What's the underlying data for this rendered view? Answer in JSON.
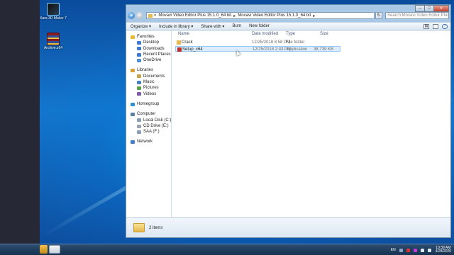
{
  "desktop": {
    "icons": [
      {
        "label": "Xara 3D Maker 7",
        "color": "#1b1b1b",
        "accent": "#7fd4ff"
      },
      {
        "label": "Archive.z64",
        "color": "#8b1c1c",
        "accent": "#e8c23a"
      }
    ]
  },
  "explorer": {
    "address_segments": [
      "Movavi Video Editor Plus 15.1.0_64 bit",
      "▸",
      "Movavi Video Editor Plus 15.1.0_64 bit",
      "▸"
    ],
    "search_placeholder": "Search Movavi Video Editor Plus 15.1.0_64 bit",
    "window_controls": [
      "–",
      "□",
      "x"
    ],
    "toolbar": [
      "Organize ▾",
      "Include in library ▾",
      "Share with ▾",
      "Burn",
      "New folder"
    ],
    "nav_groups": [
      {
        "items": [
          {
            "label": "Favorites",
            "color": "#e7b930",
            "name": "nav-favorites"
          },
          {
            "label": "Desktop",
            "color": "#3a7bd5",
            "name": "nav-desktop"
          },
          {
            "label": "Downloads",
            "color": "#3a7bd5",
            "name": "nav-downloads"
          },
          {
            "label": "Recent Places",
            "color": "#3a7bd5",
            "name": "nav-recent-places"
          },
          {
            "label": "OneDrive",
            "color": "#4f8fe0",
            "name": "nav-onedrive"
          }
        ]
      },
      {
        "items": [
          {
            "label": "Libraries",
            "color": "#d9a23b",
            "name": "nav-libraries"
          },
          {
            "label": "Documents",
            "color": "#c9a24a",
            "name": "nav-documents"
          },
          {
            "label": "Music",
            "color": "#4a7fc9",
            "name": "nav-music"
          },
          {
            "label": "Pictures",
            "color": "#5aa14a",
            "name": "nav-pictures"
          },
          {
            "label": "Videos",
            "color": "#7d5ab0",
            "name": "nav-videos"
          }
        ]
      },
      {
        "items": [
          {
            "label": "Homegroup",
            "color": "#2f8fd0",
            "name": "nav-homegroup"
          }
        ]
      },
      {
        "items": [
          {
            "label": "Computer",
            "color": "#5a7fa8",
            "name": "nav-computer"
          },
          {
            "label": "Local Disk (C:)",
            "color": "#8aa0b8",
            "name": "nav-local-disk"
          },
          {
            "label": "CD Drive (E:)",
            "color": "#9aa6b3",
            "name": "nav-cd-drive"
          },
          {
            "label": "SAA (F:)",
            "color": "#8aa0b8",
            "name": "nav-saa-drive"
          }
        ]
      },
      {
        "items": [
          {
            "label": "Network",
            "color": "#3f7ec2",
            "name": "nav-network"
          }
        ]
      }
    ],
    "columns": {
      "name": "Name",
      "date": "Date modified",
      "type": "Type",
      "size": "Size"
    },
    "files": [
      {
        "name": "Crack",
        "date": "12/25/2018 8:58 PM",
        "type": "File folder",
        "size": "",
        "icon_color": "#e6b94a"
      },
      {
        "name": "Setup_x64",
        "date": "12/25/2018 2:43 PM",
        "type": "Application",
        "size": "38,739 KB",
        "icon_color": "#b8322a"
      }
    ],
    "status": "2 items"
  },
  "taskbar": {
    "language": "EN",
    "time": "10:39 AM",
    "date": "4/28/2020"
  }
}
